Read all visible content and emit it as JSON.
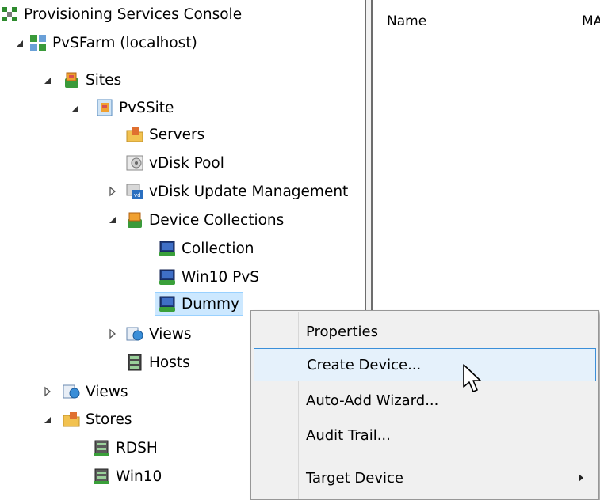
{
  "tree": {
    "root": "Provisioning Services Console",
    "farm": "PvSFarm (localhost)",
    "sites": "Sites",
    "site": "PvSSite",
    "servers": "Servers",
    "vdisk_pool": "vDisk Pool",
    "vdisk_update": "vDisk Update Management",
    "device_collections": "Device Collections",
    "collection": "Collection",
    "win10_pvs": "Win10 PvS",
    "dummy": "Dummy",
    "site_views": "Views",
    "hosts": "Hosts",
    "farm_views": "Views",
    "stores": "Stores",
    "rdsh": "RDSH",
    "win10": "Win10"
  },
  "list": {
    "col_name": "Name",
    "col_mac": "MAC"
  },
  "context_menu": {
    "items": [
      "Properties",
      "Create Device...",
      "Auto-Add Wizard...",
      "Audit Trail...",
      "Target Device"
    ],
    "highlighted": "Create Device..."
  },
  "colors": {
    "selection": "#cce8ff",
    "menu_highlight": "#e5f1fb",
    "menu_border_highlight": "#3b8fd9",
    "menu_bg": "#f0f0f0"
  }
}
